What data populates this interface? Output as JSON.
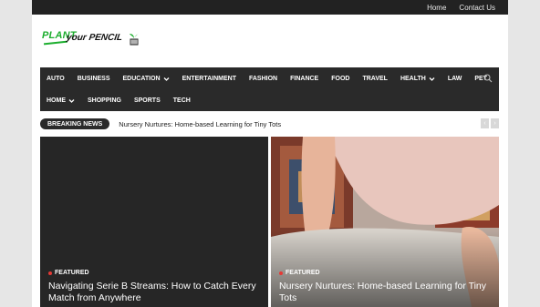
{
  "topbar": {
    "links": [
      "Home",
      "Contact Us"
    ]
  },
  "logo": {
    "word1": "PLANT",
    "word2": "your PENCIL"
  },
  "nav": {
    "row1": [
      {
        "label": "AUTO",
        "dropdown": false
      },
      {
        "label": "BUSINESS",
        "dropdown": false
      },
      {
        "label": "EDUCATION",
        "dropdown": true
      },
      {
        "label": "ENTERTAINMENT",
        "dropdown": false
      },
      {
        "label": "FASHION",
        "dropdown": false
      },
      {
        "label": "FINANCE",
        "dropdown": false
      },
      {
        "label": "FOOD",
        "dropdown": false
      },
      {
        "label": "TRAVEL",
        "dropdown": false
      },
      {
        "label": "HEALTH",
        "dropdown": true
      },
      {
        "label": "LAW",
        "dropdown": false
      },
      {
        "label": "PET",
        "dropdown": false
      }
    ],
    "row2": [
      {
        "label": "HOME",
        "dropdown": true
      },
      {
        "label": "SHOPPING",
        "dropdown": false
      },
      {
        "label": "SPORTS",
        "dropdown": false
      },
      {
        "label": "TECH",
        "dropdown": false
      }
    ],
    "search_icon": "search-icon"
  },
  "breaking": {
    "label": "BREAKING NEWS",
    "headline": "Nursery Nurtures: Home-based Learning for Tiny Tots",
    "prev_icon": "chevron-left-icon",
    "next_icon": "chevron-right-icon"
  },
  "cards": [
    {
      "badge": "FEATURED",
      "title": "Navigating Serie B Streams: How to Catch Every Match from Anywhere"
    },
    {
      "badge": "FEATURED",
      "title": "Nursery Nurtures: Home-based Learning for Tiny Tots"
    }
  ],
  "colors": {
    "brand_green": "#1cae2e",
    "nav_bg": "#2a2a2a",
    "badge_dot": "#e53935"
  }
}
